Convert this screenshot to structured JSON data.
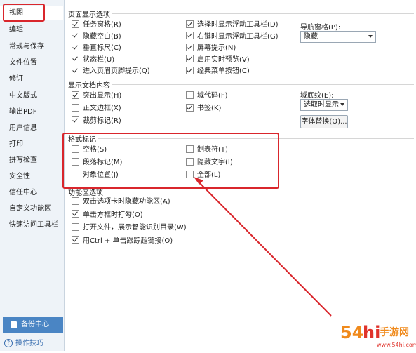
{
  "sidebar": {
    "items": [
      "视图",
      "编辑",
      "常规与保存",
      "文件位置",
      "修订",
      "中文版式",
      "输出PDF",
      "用户信息",
      "打印",
      "拼写检查",
      "安全性",
      "信任中心",
      "自定义功能区",
      "快速访问工具栏"
    ],
    "backup_label": "备份中心",
    "tips_label": "操作技巧"
  },
  "page_display": {
    "title": "页面显示选项",
    "left": [
      {
        "label": "任务窗格(R)",
        "checked": true
      },
      {
        "label": "隐藏空白(B)",
        "checked": true
      },
      {
        "label": "垂直标尺(C)",
        "checked": true
      },
      {
        "label": "状态栏(U)",
        "checked": true
      },
      {
        "label": "进入页眉页脚提示(Q)",
        "checked": true
      }
    ],
    "right": [
      {
        "label": "选择时显示浮动工具栏(D)",
        "checked": true
      },
      {
        "label": "右键时显示浮动工具栏(G)",
        "checked": true
      },
      {
        "label": "屏幕提示(N)",
        "checked": true
      },
      {
        "label": "启用实时预览(V)",
        "checked": true
      },
      {
        "label": "经典菜单按钮(C)",
        "checked": true
      }
    ],
    "nav_pane_label": "导航窗格(P):",
    "nav_pane_value": "隐藏"
  },
  "doc_content": {
    "title": "显示文档内容",
    "left": [
      {
        "label": "突出显示(H)",
        "checked": true
      },
      {
        "label": "正文边框(X)",
        "checked": false
      },
      {
        "label": "裁剪标记(R)",
        "checked": true
      }
    ],
    "right": [
      {
        "label": "域代码(F)",
        "checked": false
      },
      {
        "label": "书签(K)",
        "checked": true
      }
    ],
    "field_shading_label": "域底纹(E):",
    "field_shading_value": "选取时显示",
    "font_replace_label": "字体替换(O)..."
  },
  "format_marks": {
    "title": "格式标记",
    "left": [
      {
        "label": "空格(S)",
        "checked": false
      },
      {
        "label": "段落标记(M)",
        "checked": false
      },
      {
        "label": "对象位置(J)",
        "checked": false
      }
    ],
    "right": [
      {
        "label": "制表符(T)",
        "checked": false
      },
      {
        "label": "隐藏文字(I)",
        "checked": false
      },
      {
        "label": "全部(L)",
        "checked": false
      }
    ]
  },
  "ribbon": {
    "title": "功能区选项",
    "items": [
      {
        "label": "双击选项卡时隐藏功能区(A)",
        "checked": false
      },
      {
        "label": "单击方框时打勾(O)",
        "checked": true
      },
      {
        "label": "打开文件，展示智能识别目录(W)",
        "checked": false
      },
      {
        "label": "用Ctrl + 单击跟踪超链接(O)",
        "checked": true
      }
    ]
  },
  "watermark": {
    "text": "54hi手游网",
    "sub": "www.54hi.com",
    "colors": {
      "orange": "#f08a1c",
      "red": "#e0332b"
    }
  }
}
